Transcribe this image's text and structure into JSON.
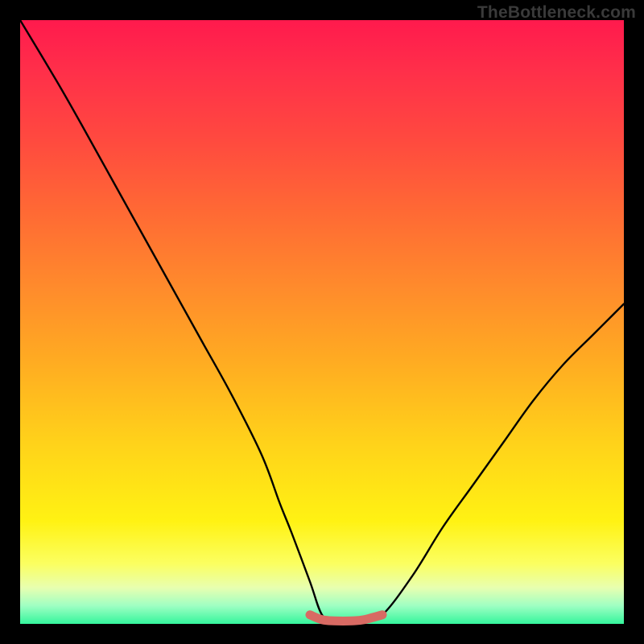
{
  "watermark": "TheBottleneck.com",
  "chart_data": {
    "type": "line",
    "title": "",
    "xlabel": "",
    "ylabel": "",
    "xlim": [
      0,
      100
    ],
    "ylim": [
      0,
      100
    ],
    "grid": false,
    "legend": false,
    "series": [
      {
        "name": "main-curve",
        "color": "#000000",
        "x": [
          0,
          6,
          10,
          15,
          20,
          25,
          30,
          35,
          40,
          43,
          45,
          48,
          50,
          52,
          55,
          57,
          60,
          65,
          70,
          75,
          80,
          85,
          90,
          95,
          100
        ],
        "y": [
          100,
          90,
          83,
          74,
          65,
          56,
          47,
          38,
          28,
          20,
          15,
          7,
          1.5,
          0.7,
          0.5,
          0.7,
          1.5,
          8,
          16,
          23,
          30,
          37,
          43,
          48,
          53
        ]
      },
      {
        "name": "flat-segment",
        "color": "#d86a63",
        "x": [
          48,
          50,
          52,
          55,
          57,
          60
        ],
        "y": [
          1.5,
          0.7,
          0.5,
          0.5,
          0.7,
          1.5
        ]
      }
    ],
    "background_gradient": {
      "top": "#ff1a4d",
      "bottom": "#34f59c"
    }
  }
}
